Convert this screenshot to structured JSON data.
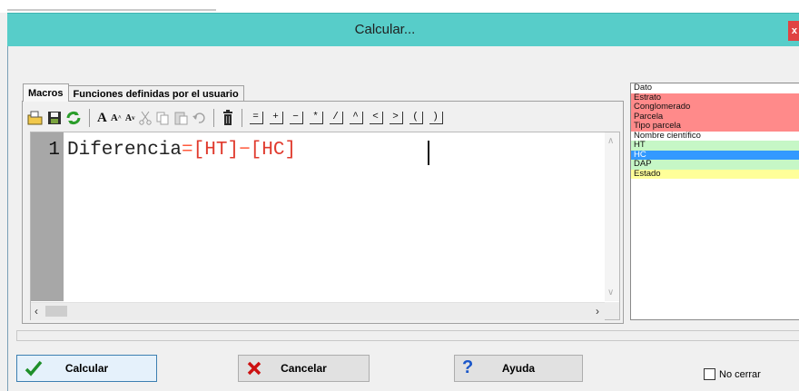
{
  "window": {
    "title": "Calcular...",
    "close_label": "x"
  },
  "tabs": [
    {
      "label": "Macros",
      "active": true
    },
    {
      "label": "Funciones definidas por el usuario",
      "active": false
    }
  ],
  "toolbar": {
    "icons": [
      "open-file-icon",
      "save-icon",
      "refresh-icon",
      "font-bold-icon",
      "font-larger-icon",
      "font-smaller-icon",
      "cut-icon",
      "copy-icon",
      "paste-icon",
      "undo-icon",
      "delete-icon"
    ],
    "font_labels": [
      "A",
      "A",
      "A"
    ],
    "operators": [
      "=",
      "+",
      "−",
      "*",
      "/",
      "^",
      "<",
      ">",
      "(",
      ")"
    ]
  },
  "editor": {
    "line_number": "1",
    "tokens": [
      {
        "text": "Diferencia",
        "kind": "ident"
      },
      {
        "text": "=",
        "kind": "op"
      },
      {
        "text": "[HT]",
        "kind": "ref"
      },
      {
        "text": "−",
        "kind": "op"
      },
      {
        "text": "[HC]",
        "kind": "ref"
      }
    ]
  },
  "fields": {
    "items": [
      {
        "label": "Dato",
        "bg": "#ffffff"
      },
      {
        "label": "Estrato",
        "bg": "#ff8a8a"
      },
      {
        "label": "Conglomerado",
        "bg": "#ff8a8a"
      },
      {
        "label": "Parcela",
        "bg": "#ff8a8a"
      },
      {
        "label": "Tipo parcela",
        "bg": "#ff8a8a"
      },
      {
        "label": "Nombre científico",
        "bg": "#ffffff"
      },
      {
        "label": "HT",
        "bg": "#c6f7c6"
      },
      {
        "label": "HC",
        "bg": "#3399ff",
        "selected": true
      },
      {
        "label": "DAP",
        "bg": "#c6f7c6"
      },
      {
        "label": "Estado",
        "bg": "#ffff99"
      }
    ]
  },
  "buttons": {
    "calcular": "Calcular",
    "cancelar": "Cancelar",
    "ayuda": "Ayuda"
  },
  "checkbox": {
    "label": "No cerrar",
    "checked": false
  },
  "colors": {
    "titlebar": "#57cdc9",
    "operator": "#ff5a3c",
    "reference": "#e03a2d",
    "selection": "#3399ff"
  }
}
